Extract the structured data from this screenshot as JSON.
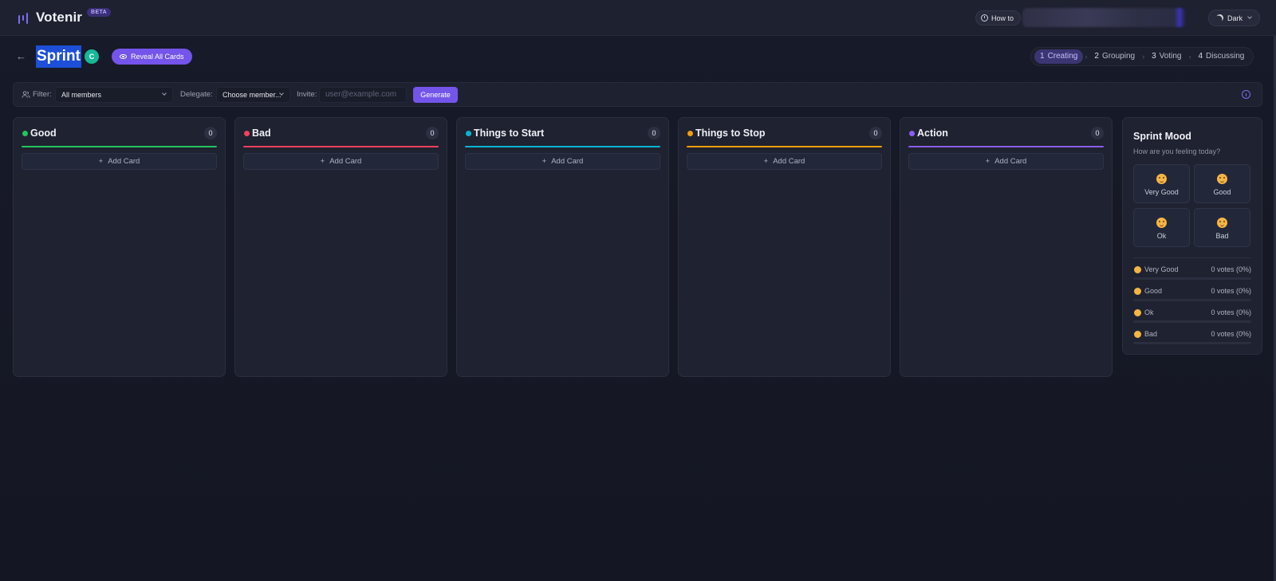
{
  "app": {
    "name": "Votenir",
    "badge": "BETA"
  },
  "header": {
    "howto_label": "How to",
    "theme_label": "Dark"
  },
  "board": {
    "title": "Sprint",
    "avatar_initial": "C",
    "reveal_label": "Reveal All Cards"
  },
  "steps": [
    {
      "num": "1",
      "label": "Creating",
      "active": true
    },
    {
      "num": "2",
      "label": "Grouping",
      "active": false
    },
    {
      "num": "3",
      "label": "Voting",
      "active": false
    },
    {
      "num": "4",
      "label": "Discussing",
      "active": false
    }
  ],
  "filterbar": {
    "filter_label": "Filter:",
    "filter_value": "All members",
    "delegate_label": "Delegate:",
    "delegate_value": "Choose member...",
    "invite_label": "Invite:",
    "invite_placeholder": "user@example.com",
    "generate_label": "Generate"
  },
  "columns": [
    {
      "title": "Good",
      "count": "0",
      "color": "#22c55e",
      "add_label": "Add Card"
    },
    {
      "title": "Bad",
      "count": "0",
      "color": "#f43f5e",
      "add_label": "Add Card"
    },
    {
      "title": "Things to Start",
      "count": "0",
      "color": "#06b6d4",
      "add_label": "Add Card"
    },
    {
      "title": "Things to Stop",
      "count": "0",
      "color": "#f59e0b",
      "add_label": "Add Card"
    },
    {
      "title": "Action",
      "count": "0",
      "color": "#8b5cf6",
      "add_label": "Add Card"
    }
  ],
  "mood": {
    "title": "Sprint Mood",
    "subtitle": "How are you feeling today?",
    "options": [
      {
        "label": "Very Good",
        "icon": "grinning-face-icon"
      },
      {
        "label": "Good",
        "icon": "smiling-face-icon"
      },
      {
        "label": "Ok",
        "icon": "neutral-face-icon"
      },
      {
        "label": "Bad",
        "icon": "frowning-face-icon"
      }
    ],
    "stats": [
      {
        "label": "Very Good",
        "value": "0 votes (0%)",
        "percent": 0
      },
      {
        "label": "Good",
        "value": "0 votes (0%)",
        "percent": 0
      },
      {
        "label": "Ok",
        "value": "0 votes (0%)",
        "percent": 0
      },
      {
        "label": "Bad",
        "value": "0 votes (0%)",
        "percent": 0
      }
    ]
  },
  "colors": {
    "accent": "#7455ea",
    "background": "#161827",
    "panel": "#1f2230"
  }
}
